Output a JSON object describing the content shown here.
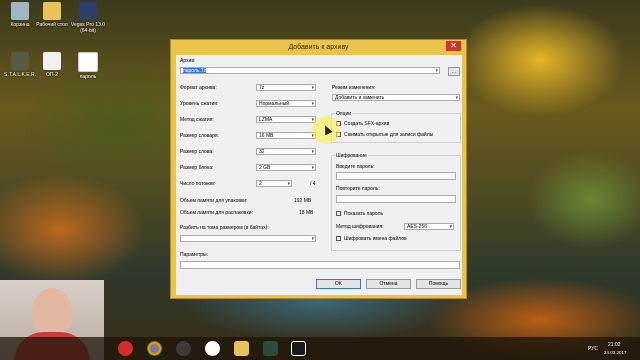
{
  "desktop": {
    "icons": [
      {
        "label": "Корзина",
        "icon": "recycle-bin-icon"
      },
      {
        "label": "Рабочий стол",
        "icon": "desktop-folder-icon"
      },
      {
        "label": "Vegas Pro 13.0 (64-bit)",
        "icon": "vegas-icon"
      },
      {
        "label": "S.T.A.L.K.E.R.",
        "icon": "stalker-icon"
      },
      {
        "label": "ОП-2",
        "icon": "document-icon"
      },
      {
        "label": "пароль",
        "icon": "text-file-icon"
      }
    ]
  },
  "dialog": {
    "title": "Добавить к архиву",
    "close": "✕",
    "archive_label": "Архив:",
    "archive_value": "пароль.7z",
    "browse": "...",
    "format_label": "Формат архива:",
    "format_value": "7z",
    "level_label": "Уровень сжатия:",
    "level_value": "Нормальный",
    "method_label": "Метод сжатия:",
    "method_value": "LZMA",
    "dict_label": "Размер словаря:",
    "dict_value": "16 MB",
    "word_label": "Размер слова:",
    "word_value": "32",
    "block_label": "Размер блока:",
    "block_value": "2 GB",
    "threads_label": "Число потоков:",
    "threads_value": "2",
    "threads_max": "/ 4",
    "mem_pack_label": "Объем памяти для упаковки:",
    "mem_pack_value": "192 MB",
    "mem_unpack_label": "Объем памяти для распаковки:",
    "mem_unpack_value": "18 MB",
    "split_label": "Разбить на тома размером (в байтах):",
    "split_value": "",
    "params_label": "Параметры:",
    "params_value": "",
    "mode_label": "Режим изменения:",
    "mode_value": "Добавить и заменить",
    "options_title": "Опции",
    "opt_sfx": "Создать SFX-архив",
    "opt_shared": "Сжимать открытые для записи файлы",
    "enc_title": "Шифрование",
    "pwd_label": "Введите пароль:",
    "pwd2_label": "Повторите пароль:",
    "show_pwd": "Показать пароль",
    "enc_method_label": "Метод шифрования:",
    "enc_method_value": "AES-256",
    "enc_names": "Шифровать имена файлов",
    "ok": "OK",
    "cancel": "Отмена",
    "help": "Помощь"
  },
  "taskbar": {
    "apps": [
      "opera-icon",
      "chrome-icon",
      "media-icon",
      "yandex-icon",
      "folder-icon",
      "video-icon",
      "7zip-icon"
    ],
    "lang": "РУС",
    "time": "21:02",
    "date": "24.03.2017"
  }
}
